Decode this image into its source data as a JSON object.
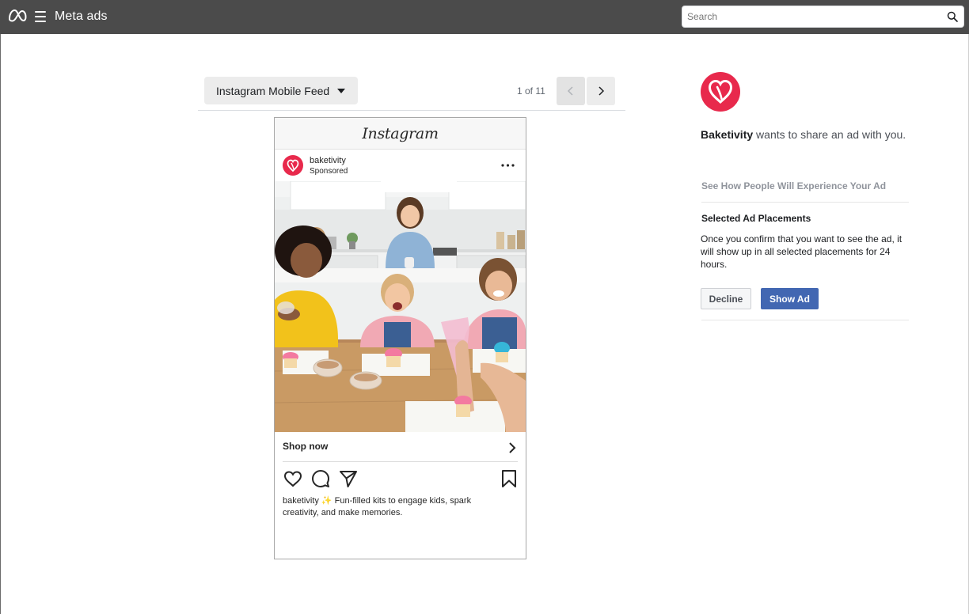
{
  "topbar": {
    "brand": "Meta ads",
    "search_placeholder": "Search"
  },
  "preview": {
    "placement": "Instagram Mobile Feed",
    "pager": "1 of 11"
  },
  "post": {
    "platform": "Instagram",
    "account_name": "baketivity",
    "account_sub": "Sponsored",
    "cta": "Shop now",
    "caption_name": "baketivity",
    "caption_text": "✨ Fun-filled kits to engage kids, spark creativity, and make memories."
  },
  "panel": {
    "advertiser": "Baketivity",
    "share_text": " wants to share an ad with you.",
    "see_how": "See How People Will Experience Your Ad",
    "selected_title": "Selected Ad Placements",
    "selected_desc": "Once you confirm that you want to see the ad, it will show up in all selected placements for 24 hours.",
    "decline_label": "Decline",
    "show_label": "Show Ad"
  },
  "colors": {
    "topbar": "#4b4b4b",
    "brand_red": "#e8294c",
    "primary_button": "#4267b2"
  }
}
